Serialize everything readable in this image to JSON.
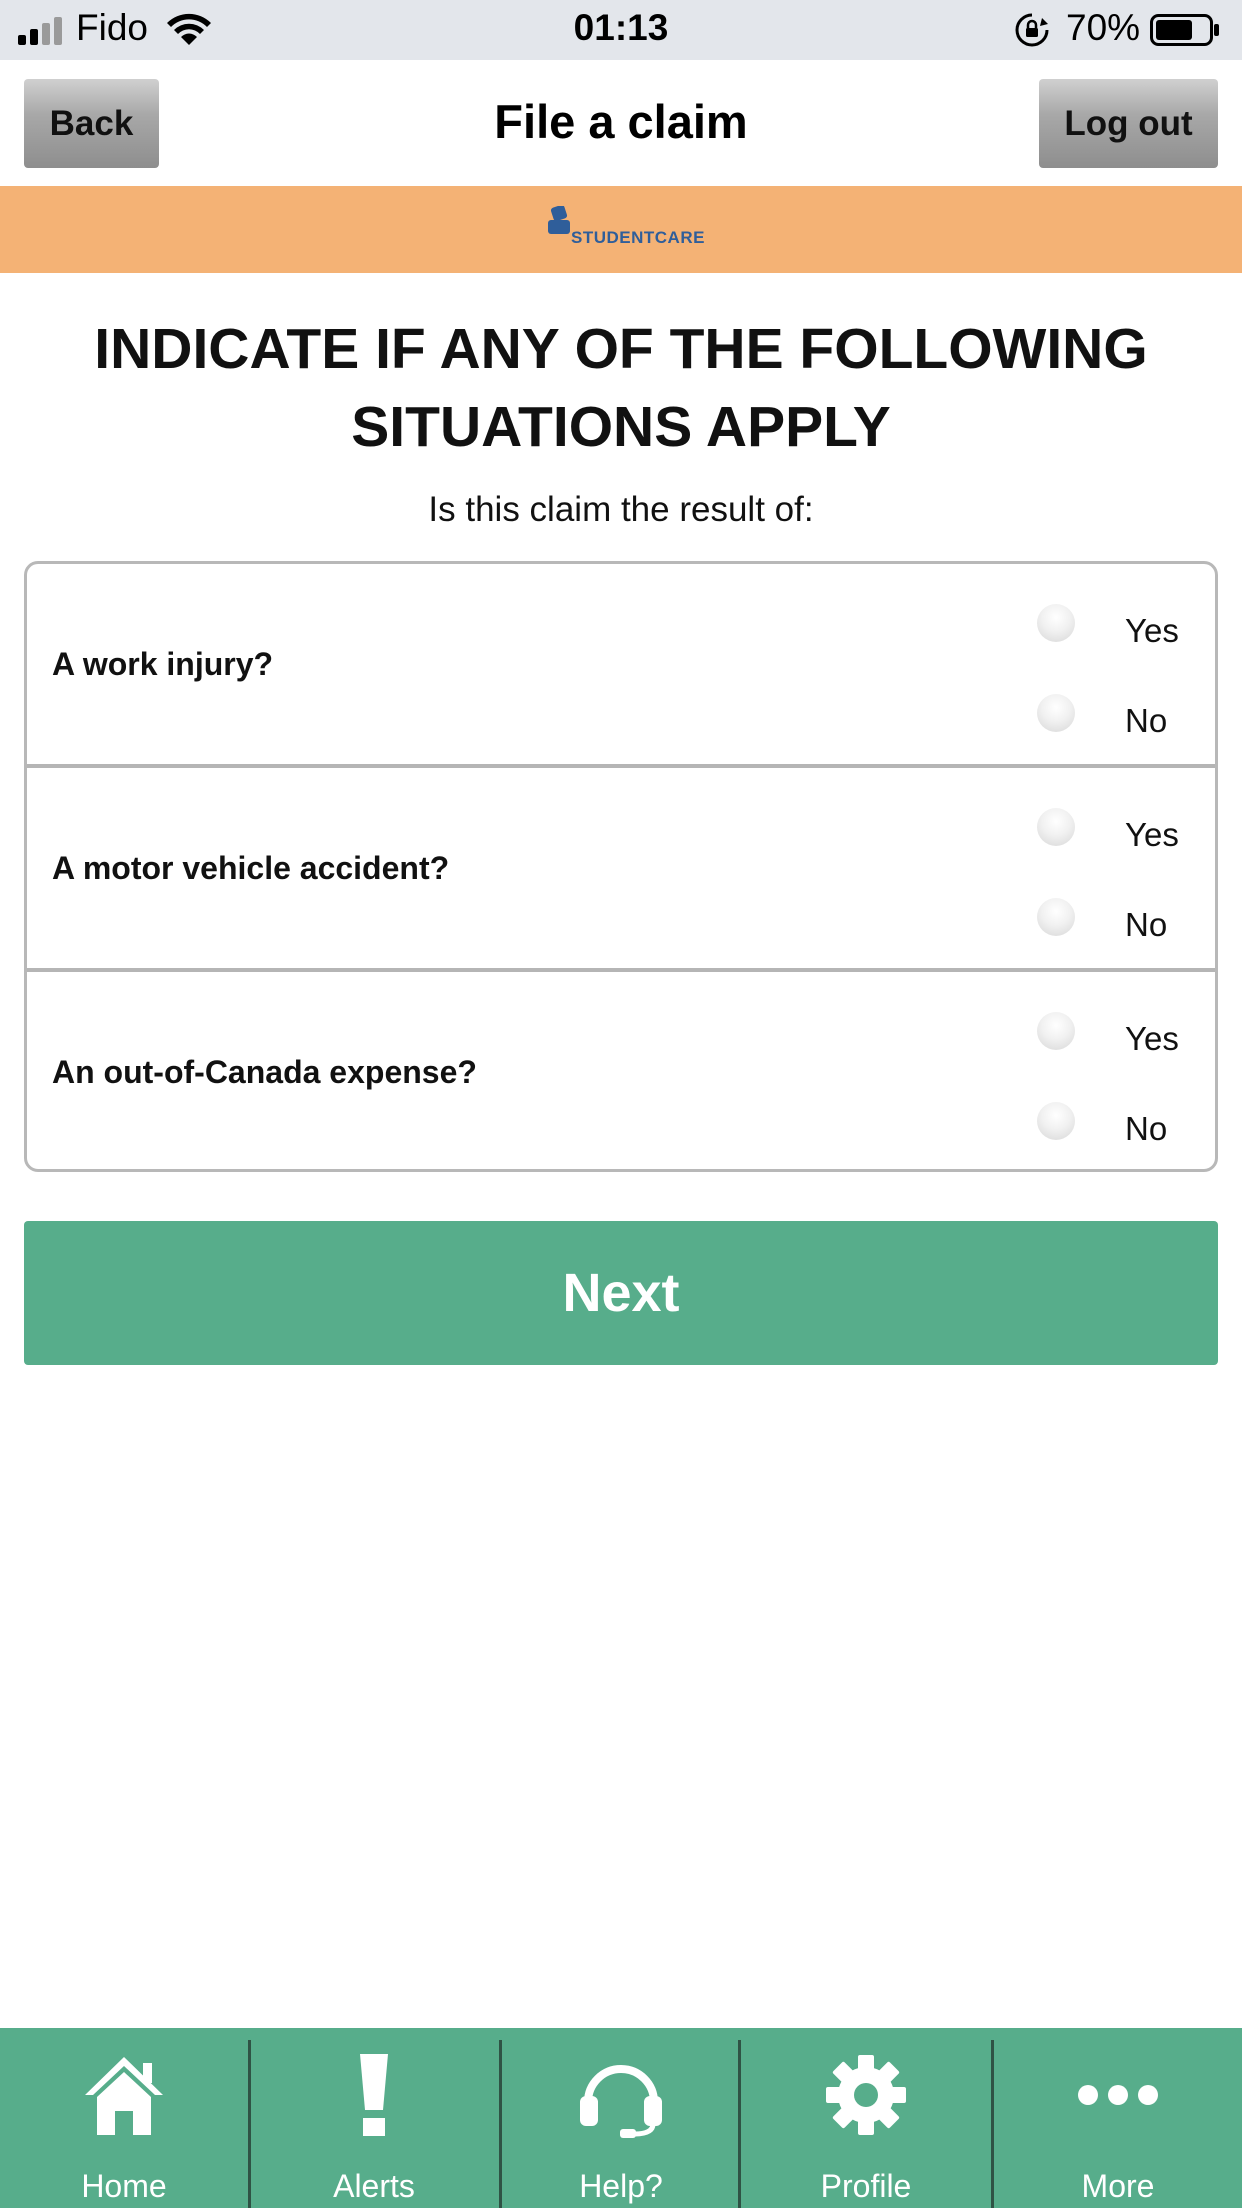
{
  "status_bar": {
    "carrier": "Fido",
    "time": "01:13",
    "battery_percent": "70%",
    "battery_level": 0.7,
    "icons": [
      "signal-icon",
      "wifi-icon",
      "rotation-lock-icon",
      "battery-icon"
    ]
  },
  "header": {
    "back_label": "Back",
    "title": "File a claim",
    "logout_label": "Log out"
  },
  "banner": {
    "brand_text": "STUDENTCARE",
    "background_color": "#f4b275"
  },
  "form": {
    "heading": "INDICATE IF ANY OF THE FOLLOWING SITUATIONS APPLY",
    "subheading": "Is this claim the result of:",
    "questions": [
      {
        "label": "A work injury?",
        "yes_label": "Yes",
        "no_label": "No",
        "selected": null
      },
      {
        "label": "A motor vehicle accident?",
        "yes_label": "Yes",
        "no_label": "No",
        "selected": null
      },
      {
        "label": "An out-of-Canada expense?",
        "yes_label": "Yes",
        "no_label": "No",
        "selected": null
      }
    ],
    "next_label": "Next",
    "accent_color": "#57ad8b"
  },
  "tab_bar": {
    "items": [
      {
        "label": "Home",
        "icon": "home-icon"
      },
      {
        "label": "Alerts",
        "icon": "alert-icon"
      },
      {
        "label": "Help?",
        "icon": "headset-icon"
      },
      {
        "label": "Profile",
        "icon": "gear-icon"
      },
      {
        "label": "More",
        "icon": "more-icon"
      }
    ]
  }
}
